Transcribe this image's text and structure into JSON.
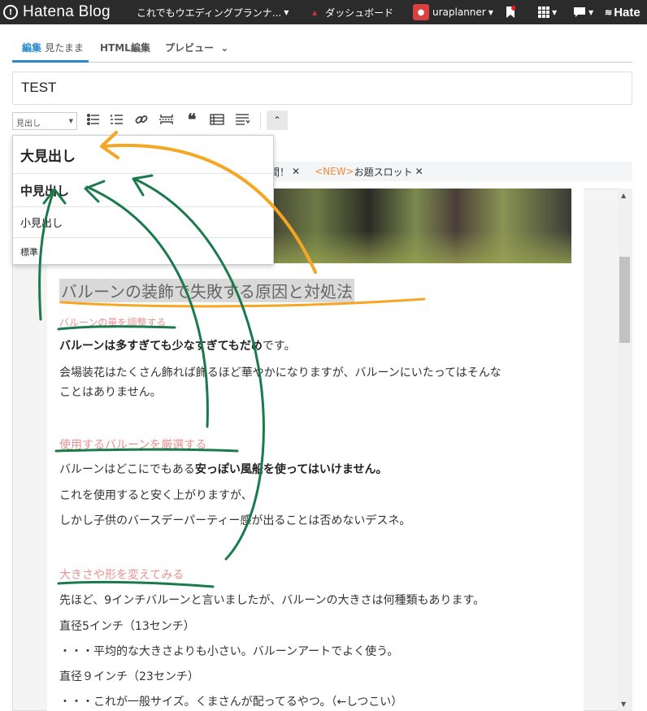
{
  "topbar": {
    "logo": "Hatena Blog",
    "blog_name": "これでもウエディングプランナ...",
    "dashboard": "ダッシュボード",
    "username": "uraplanner",
    "hatena_cut": "Hate"
  },
  "tabs": [
    {
      "label": "編集",
      "sub": "見たまま"
    },
    {
      "label": "HTML編集"
    },
    {
      "label": "プレビュー"
    }
  ],
  "title_value": "TEST",
  "toolbar": {
    "format_select": "見出し"
  },
  "dropdown": {
    "items": [
      "大見出し",
      "中見出し",
      "小見出し",
      "標準"
    ]
  },
  "tags": {
    "tag1": "週間！",
    "new_label": "<NEW>",
    "tag2": "お題スロット"
  },
  "content": {
    "heading_large": "バルーンの装飾で失敗する原因と対処法",
    "sub1": "バルーンの量を調整する",
    "p1_bold": "バルーンは多すぎても少なすぎてもだめ",
    "p1_rest": "です。",
    "p2_line1": "会場装花はたくさん飾れば飾るほど華やかになりますが、バルーンにいたってはそんな",
    "p2_line2": "ことはありません。",
    "sub2": "使用するバルーンを厳選する",
    "p3_pre": "バルーンはどこにでもある",
    "p3_bold": "安っぽい風船を使ってはいけません。",
    "p4": "これを使用すると安く上がりますが、",
    "p5": "しかし子供のバースデーパーティー感が出ることは否めないデスネ。",
    "sub3": "大きさや形を変えてみる",
    "p6": "先ほど、9インチバルーンと言いましたが、バルーンの大きさは何種類もあります。",
    "p7": "直径5インチ（13センチ）",
    "p8": "・・・平均的な大きさよりも小さい。バルーンアートでよく使う。",
    "p9": "直径９インチ（23センチ）",
    "p10": "・・・これが一般サイズ。くまさんが配ってるやつ。（←しつこい）"
  },
  "colors": {
    "accent": "#2a8ac9",
    "annotation_orange": "#f5a623",
    "annotation_green": "#1a7a4c",
    "heading_pink": "#e89090"
  }
}
